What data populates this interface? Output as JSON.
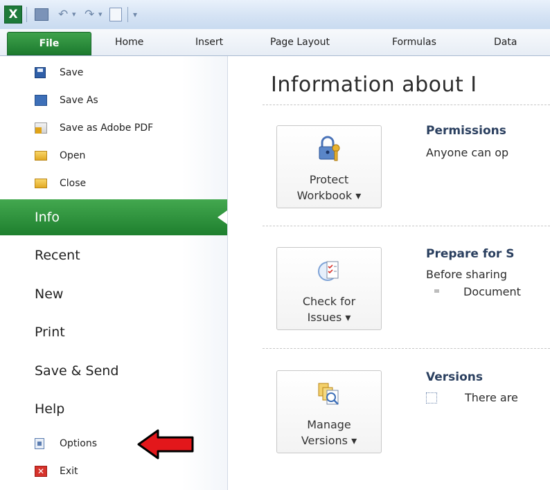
{
  "window": {
    "app_icon": "excel-icon",
    "quick_access": [
      "save-icon",
      "undo-icon",
      "redo-icon",
      "print-preview-icon"
    ]
  },
  "ribbon": {
    "tabs": [
      "File",
      "Home",
      "Insert",
      "Page Layout",
      "Formulas",
      "Data"
    ]
  },
  "backstage": {
    "commands_top": [
      {
        "label": "Save",
        "icon": "save-icon"
      },
      {
        "label": "Save As",
        "icon": "save-as-icon"
      },
      {
        "label": "Save as Adobe PDF",
        "icon": "pdf-icon"
      },
      {
        "label": "Open",
        "icon": "open-folder-icon"
      },
      {
        "label": "Close",
        "icon": "close-folder-icon"
      }
    ],
    "tabs": [
      "Info",
      "Recent",
      "New",
      "Print",
      "Save & Send",
      "Help"
    ],
    "selected_tab": "Info",
    "commands_bottom": [
      {
        "label": "Options",
        "icon": "options-icon"
      },
      {
        "label": "Exit",
        "icon": "exit-icon"
      }
    ],
    "annotation": {
      "icon": "red-arrow-icon",
      "color": "#e3171b"
    }
  },
  "info": {
    "title": "Information about I",
    "sections": [
      {
        "button": {
          "label": "Protect\nWorkbook ▾",
          "icon": "lock-key-icon"
        },
        "heading": "Permissions",
        "text": "Anyone can op"
      },
      {
        "button": {
          "label": "Check for\nIssues ▾",
          "icon": "checklist-icon"
        },
        "heading": "Prepare for S",
        "text": "Before sharing",
        "bullet": "Document"
      },
      {
        "button": {
          "label": "Manage\nVersions ▾",
          "icon": "versions-icon"
        },
        "heading": "Versions",
        "text": "There are"
      }
    ]
  },
  "colors": {
    "file_green": "#1c7a2e",
    "info_green": "#43a84f",
    "arrow_red": "#e3171b"
  }
}
